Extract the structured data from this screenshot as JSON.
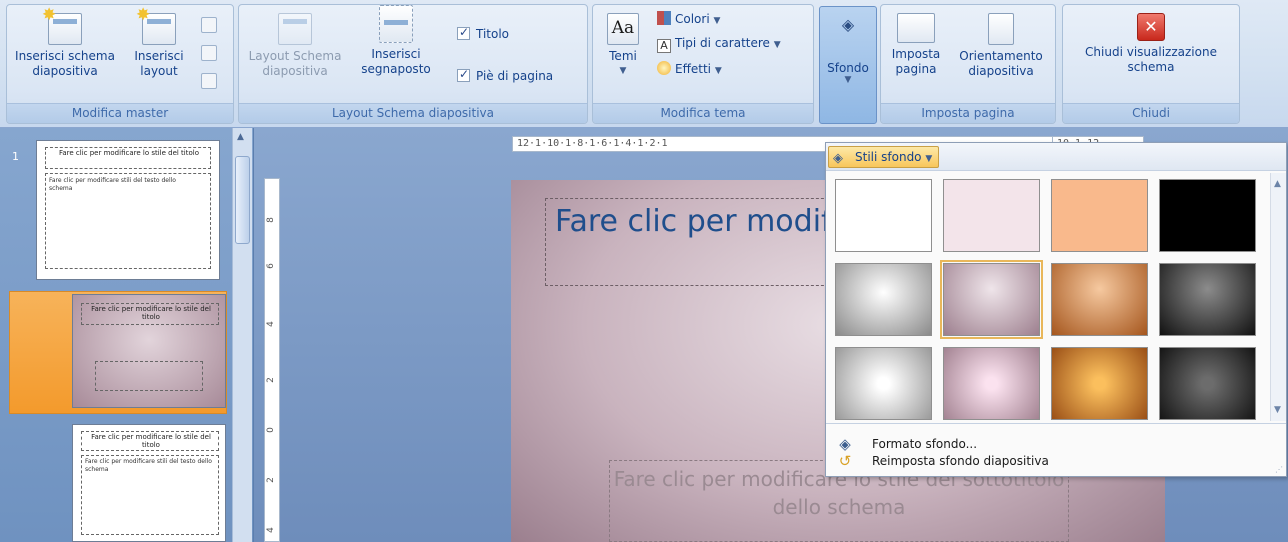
{
  "ribbon": {
    "groups": {
      "master": {
        "label": "Modifica master",
        "insert_master": "Inserisci schema diapositiva",
        "insert_layout": "Inserisci layout"
      },
      "layout": {
        "label": "Layout Schema diapositiva",
        "layout_master": "Layout Schema diapositiva",
        "insert_placeholder": "Inserisci segnaposto",
        "titolo": "Titolo",
        "footer": "Piè di pagina"
      },
      "theme": {
        "label": "Modifica tema",
        "temi": "Temi",
        "colori": "Colori",
        "fonts": "Tipi di carattere",
        "effetti": "Effetti"
      },
      "sfondo": {
        "label": "Sfondo"
      },
      "page": {
        "label": "Imposta pagina",
        "setup": "Imposta pagina",
        "orientation": "Orientamento diapositiva"
      },
      "close": {
        "label": "Chiudi",
        "close_view": "Chiudi visualizzazione schema"
      }
    }
  },
  "thumbnails": {
    "slide_number": "1",
    "thumb_title": "Fare clic per modificare lo stile del titolo",
    "thumb_text": "Fare clic per modificare stili del testo dello schema"
  },
  "rulers": {
    "horizontal_left": "12·1·10·1·8·1·6·1·4·1·2·1",
    "horizontal_right": "10·1·12",
    "vertical": [
      "8",
      "6",
      "4",
      "2",
      "0",
      "2",
      "4"
    ]
  },
  "slide": {
    "title": "Fare clic per modificare lo stile del titolo",
    "subtitle": "Fare clic per modificare lo stile del sottotitolo dello schema"
  },
  "dropdown": {
    "header": "Stili sfondo",
    "swatch_colors": [
      "#ffffff",
      "#f3e4ea",
      "#f9b98c",
      "#000000"
    ],
    "menu": {
      "format": "Formato sfondo...",
      "reset": "Reimposta sfondo diapositiva"
    }
  }
}
